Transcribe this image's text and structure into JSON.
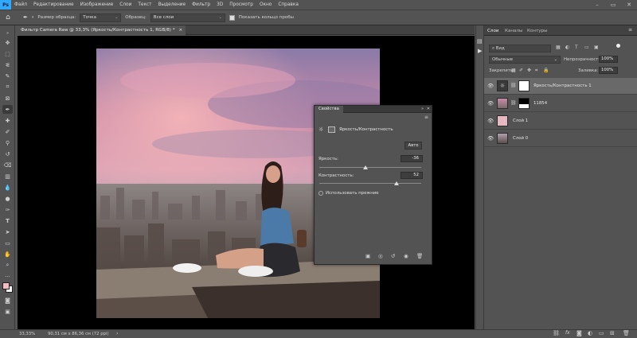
{
  "menu": [
    "Файл",
    "Редактирование",
    "Изображение",
    "Слои",
    "Текст",
    "Выделение",
    "Фильтр",
    "3D",
    "Просмотр",
    "Окно",
    "Справка"
  ],
  "options": {
    "sample_size_label": "Размер образца:",
    "sample_size_value": "Точка",
    "sample_label": "Образец:",
    "sample_value": "Все слои",
    "show_ring_label": "Показать кольцо пробы"
  },
  "document": {
    "tab_title": "Фильтр Camera Raw @ 33,3% (Яркость/Контрастность 1, RGB/8) *",
    "close": "×"
  },
  "status": {
    "zoom": "33,33%",
    "size": "90,31 см x 86,36 см (72 ppi)"
  },
  "properties": {
    "tab": "Свойства",
    "title": "Яркость/Контрастность",
    "auto_button": "Авто",
    "brightness_label": "Яркость:",
    "brightness_value": "-36",
    "brightness_fraction": 0.455,
    "contrast_label": "Контрастность:",
    "contrast_value": "52",
    "contrast_fraction": 0.76,
    "legacy_label": "Использовать прежние"
  },
  "layers_panel": {
    "tabs": [
      "Слои",
      "Каналы",
      "Контуры"
    ],
    "search_kind": "Вид",
    "blend_mode": "Обычные",
    "opacity_label": "Непрозрачность:",
    "opacity_value": "100%",
    "lock_label": "Закрепить:",
    "fill_label": "Заливка:",
    "fill_value": "100%",
    "layers": [
      {
        "name": "Яркость/Контрастность 1"
      },
      {
        "name": "11854"
      },
      {
        "name": "Слой 1"
      },
      {
        "name": "Слой 0"
      }
    ]
  },
  "colors": {
    "accent": "#31a8ff",
    "foreground": "#f0bcc0",
    "background": "#ffffff"
  }
}
